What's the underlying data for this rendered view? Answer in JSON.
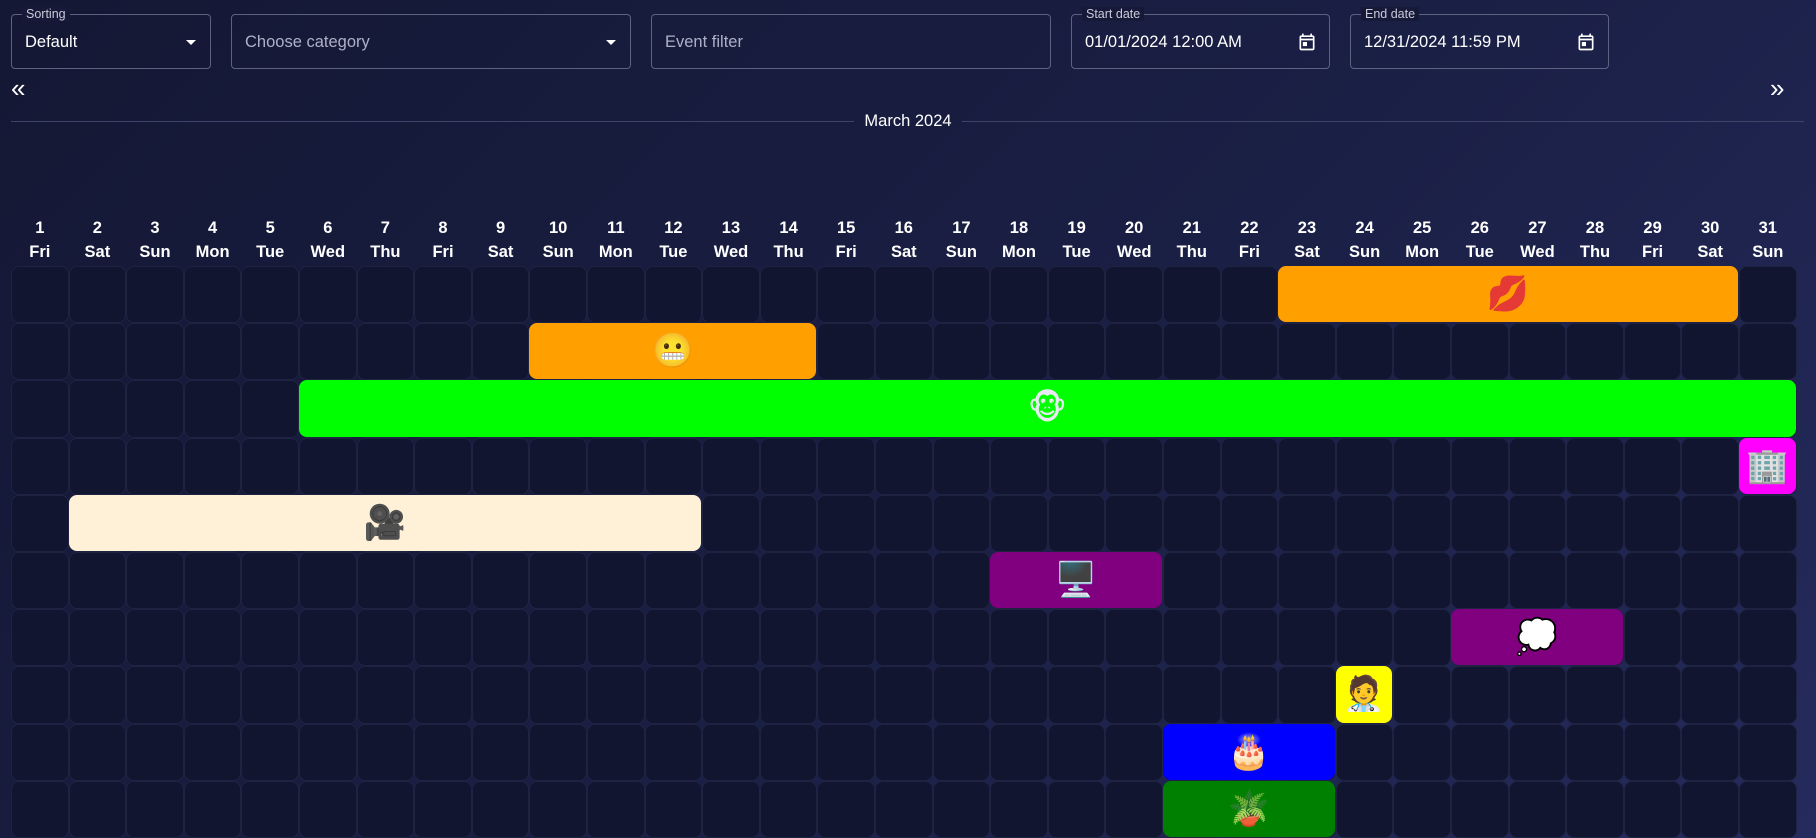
{
  "filters": {
    "sorting": {
      "label": "Sorting",
      "value": "Default"
    },
    "category": {
      "placeholder": "Choose category"
    },
    "event_filter": {
      "placeholder": "Event filter"
    },
    "start_date": {
      "label": "Start date",
      "value": "01/01/2024 12:00 AM"
    },
    "end_date": {
      "label": "End date",
      "value": "12/31/2024 11:59 PM"
    }
  },
  "nav": {
    "prev_label": "«",
    "next_label": "»"
  },
  "month": "March 2024",
  "days": [
    {
      "num": "1",
      "wd": "Fri"
    },
    {
      "num": "2",
      "wd": "Sat"
    },
    {
      "num": "3",
      "wd": "Sun"
    },
    {
      "num": "4",
      "wd": "Mon"
    },
    {
      "num": "5",
      "wd": "Tue"
    },
    {
      "num": "6",
      "wd": "Wed"
    },
    {
      "num": "7",
      "wd": "Thu"
    },
    {
      "num": "8",
      "wd": "Fri"
    },
    {
      "num": "9",
      "wd": "Sat"
    },
    {
      "num": "10",
      "wd": "Sun"
    },
    {
      "num": "11",
      "wd": "Mon"
    },
    {
      "num": "12",
      "wd": "Tue"
    },
    {
      "num": "13",
      "wd": "Wed"
    },
    {
      "num": "14",
      "wd": "Thu"
    },
    {
      "num": "15",
      "wd": "Fri"
    },
    {
      "num": "16",
      "wd": "Sat"
    },
    {
      "num": "17",
      "wd": "Sun"
    },
    {
      "num": "18",
      "wd": "Mon"
    },
    {
      "num": "19",
      "wd": "Tue"
    },
    {
      "num": "20",
      "wd": "Wed"
    },
    {
      "num": "21",
      "wd": "Thu"
    },
    {
      "num": "22",
      "wd": "Fri"
    },
    {
      "num": "23",
      "wd": "Sat"
    },
    {
      "num": "24",
      "wd": "Sun"
    },
    {
      "num": "25",
      "wd": "Mon"
    },
    {
      "num": "26",
      "wd": "Tue"
    },
    {
      "num": "27",
      "wd": "Wed"
    },
    {
      "num": "28",
      "wd": "Thu"
    },
    {
      "num": "29",
      "wd": "Fri"
    },
    {
      "num": "30",
      "wd": "Sat"
    },
    {
      "num": "31",
      "wd": "Sun"
    }
  ],
  "rows": 10,
  "events": [
    {
      "name": "kiss-mark-event",
      "emoji": "💋",
      "color": "#ffa000",
      "row": 0,
      "start": 23,
      "end": 30
    },
    {
      "name": "grimacing-face-event",
      "emoji": "😬",
      "color": "#ffa000",
      "row": 1,
      "start": 10,
      "end": 14
    },
    {
      "name": "monkey-face-event",
      "emoji": "🐵",
      "color": "#00ff00",
      "row": 2,
      "start": 6,
      "end": 31
    },
    {
      "name": "office-building-event",
      "emoji": "🏢",
      "color": "#ff00ff",
      "row": 3,
      "start": 31,
      "end": 31
    },
    {
      "name": "movie-camera-event",
      "emoji": "🎥",
      "color": "#fff0d8",
      "row": 4,
      "start": 2,
      "end": 12
    },
    {
      "name": "desktop-computer-event",
      "emoji": "🖥️",
      "color": "#800080",
      "row": 5,
      "start": 18,
      "end": 20
    },
    {
      "name": "thought-balloon-event",
      "emoji": "💭",
      "color": "#800080",
      "row": 6,
      "start": 26,
      "end": 28
    },
    {
      "name": "health-worker-event",
      "emoji": "🧑‍⚕️",
      "color": "#ffff00",
      "row": 7,
      "start": 24,
      "end": 24
    },
    {
      "name": "birthday-cake-event",
      "emoji": "🎂",
      "color": "#0000ff",
      "row": 8,
      "start": 21,
      "end": 23
    },
    {
      "name": "potted-plant-event",
      "emoji": "🪴",
      "color": "#008000",
      "row": 9,
      "start": 21,
      "end": 23
    }
  ]
}
